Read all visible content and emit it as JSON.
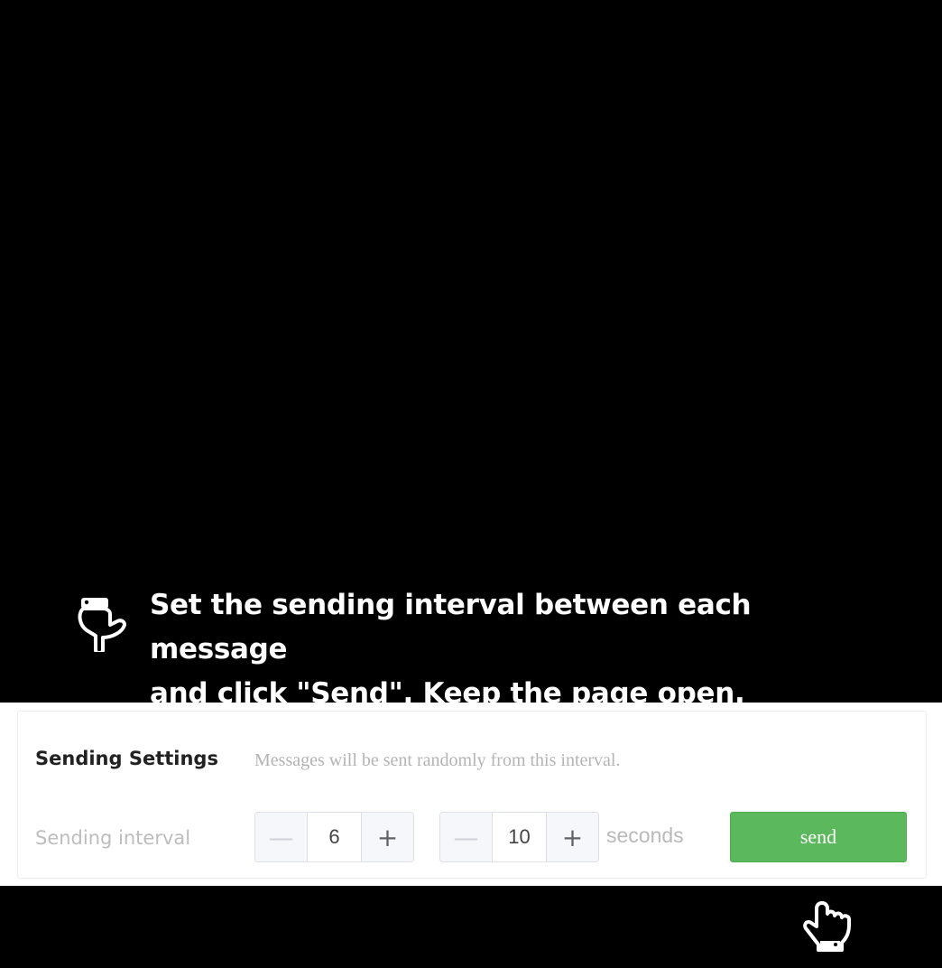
{
  "instruction": {
    "icon": "pointer-down-icon",
    "line1": "Set the sending interval between each message",
    "line2": "and click \"Send\". Keep the page open."
  },
  "settings": {
    "title": "Sending Settings",
    "hint": "Messages will be sent randomly from this interval.",
    "interval_label": "Sending interval",
    "min_value": "6",
    "max_value": "10",
    "separator": "~",
    "unit": "seconds",
    "send_label": "send",
    "minus_symbol": "—",
    "plus_symbol": "+"
  },
  "colors": {
    "background": "#000000",
    "send_button": "#5cb85c",
    "panel": "#ffffff"
  },
  "cursor": {
    "icon": "hand-cursor-icon"
  }
}
